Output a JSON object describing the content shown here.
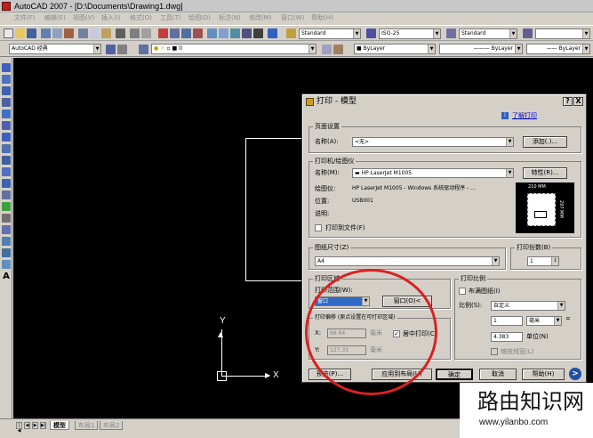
{
  "window": {
    "title": "AutoCAD 2007 - [D:\\Documents\\Drawing1.dwg]"
  },
  "menu": [
    "文件(F)",
    "编辑(E)",
    "视图(V)",
    "插入(I)",
    "格式(O)",
    "工具(T)",
    "绘图(D)",
    "标注(N)",
    "修改(M)",
    "窗口(W)",
    "帮助(H)"
  ],
  "toolbar": {
    "text_style": "Standard",
    "dim_style": "ISO-25",
    "table_style": "Standard",
    "workspace": "AutoCAD 经典",
    "layer": "0",
    "color": "ByLayer",
    "linetype": "ByLayer",
    "lineweight": "ByLayer"
  },
  "canvas": {
    "axis_x": "X",
    "axis_y": "Y"
  },
  "tabs": [
    "模型",
    "布局1",
    "布局2"
  ],
  "dialog": {
    "title": "打印 - 模型",
    "help_btn": "?",
    "close_btn": "X",
    "learn_link": "了解打印",
    "page_setup": {
      "label": "页面设置",
      "name_label": "名称(A):",
      "name_value": "<无>",
      "add_btn": "添加(.)..."
    },
    "printer": {
      "label": "打印机/绘图仪",
      "name_label": "名称(M):",
      "name_value": "HP LaserJet M1005",
      "props_btn": "特性(R)...",
      "plotter_label": "绘图仪:",
      "plotter_value": "HP LaserJet M1005 - Windows 系统驱动程序 - ...",
      "where_label": "位置:",
      "where_value": "USB001",
      "desc_label": "说明:",
      "to_file_label": "打印到文件(F)",
      "paper_width": "210 MM",
      "paper_height": "297 MM"
    },
    "paper_size": {
      "label": "图纸尺寸(Z)",
      "value": "A4"
    },
    "copies": {
      "label": "打印份数(B)",
      "value": "1"
    },
    "area": {
      "label": "打印区域",
      "range_label": "打印范围(W):",
      "range_value": "窗口",
      "window_btn": "窗口(O)<"
    },
    "offset": {
      "label": "打印偏移 (原点设置在可打印区域)",
      "x_label": "X:",
      "x_value": "68.94",
      "x_unit": "毫米",
      "y_label": "Y:",
      "y_value": "127.33",
      "y_unit": "毫米",
      "center_label": "居中打印(C)",
      "center_checked": "✓"
    },
    "scale": {
      "label": "打印比例",
      "fill_label": "布满图纸(I)",
      "ratio_label": "比例(S):",
      "ratio_value": "自定义",
      "mm_value": "1",
      "mm_unit": "毫米",
      "unit_value": "4.383",
      "unit_label": "单位(N)",
      "linewidth_label": "缩放线宽(L)",
      "eq": "="
    },
    "buttons": {
      "preview": "预览(P)...",
      "apply": "应用到布局(U)",
      "ok": "确定",
      "cancel": "取消",
      "help": "帮助(H)",
      "more": ">"
    }
  },
  "watermark": {
    "title": "路由知识网",
    "url": "www.yilanbo.com"
  }
}
